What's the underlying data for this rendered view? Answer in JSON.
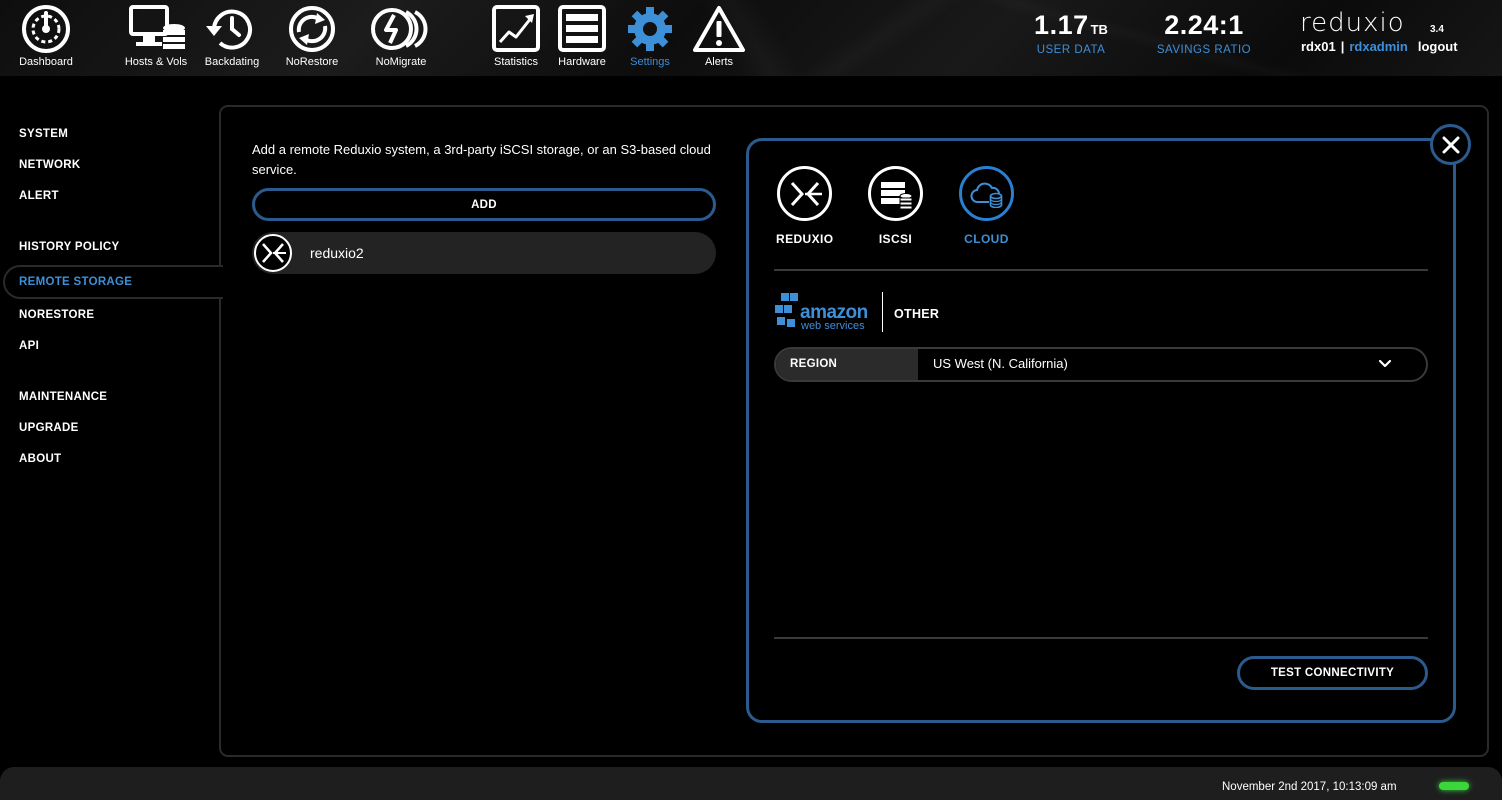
{
  "nav": {
    "items": [
      {
        "label": "Dashboard",
        "icon": "dashboard-gauge-icon"
      },
      {
        "label": "Hosts & Vols",
        "icon": "hosts-volumes-icon"
      },
      {
        "label": "Backdating",
        "icon": "backdating-clock-icon"
      },
      {
        "label": "NoRestore",
        "icon": "norestore-icon"
      },
      {
        "label": "NoMigrate",
        "icon": "nomigrate-icon"
      },
      {
        "label": "Statistics",
        "icon": "statistics-chart-icon"
      },
      {
        "label": "Hardware",
        "icon": "hardware-server-icon"
      },
      {
        "label": "Settings",
        "icon": "settings-gear-icon",
        "active": true
      },
      {
        "label": "Alerts",
        "icon": "alert-warning-icon"
      }
    ]
  },
  "stats": {
    "user_data_value": "1.17",
    "user_data_unit": "TB",
    "user_data_label": "USER DATA",
    "savings_value": "2.24:1",
    "savings_label": "SAVINGS RATIO"
  },
  "brand": {
    "name": "reduxio",
    "version": "3.4",
    "system": "rdx01",
    "separator": "|",
    "user": "rdxadmin",
    "logout": "logout"
  },
  "sidebar": {
    "items": [
      {
        "label": "SYSTEM"
      },
      {
        "label": "NETWORK"
      },
      {
        "label": "ALERT"
      },
      {
        "label": "HISTORY POLICY"
      },
      {
        "label": "REMOTE STORAGE",
        "active": true
      },
      {
        "label": "NORESTORE"
      },
      {
        "label": "API"
      },
      {
        "label": "MAINTENANCE"
      },
      {
        "label": "UPGRADE"
      },
      {
        "label": "ABOUT"
      }
    ]
  },
  "remote_storage": {
    "intro": "Add a remote Reduxio system, a 3rd-party iSCSI storage, or an S3-based cloud service.",
    "add_label": "ADD",
    "entries": [
      {
        "name": "reduxio2",
        "icon": "reduxio-logo-icon"
      }
    ]
  },
  "dialog": {
    "types": [
      {
        "label": "REDUXIO",
        "icon": "reduxio-logo-icon"
      },
      {
        "label": "ISCSI",
        "icon": "iscsi-storage-icon"
      },
      {
        "label": "CLOUD",
        "icon": "cloud-storage-icon",
        "active": true
      }
    ],
    "providers": {
      "aws_main": "amazon",
      "aws_sub": "web services",
      "other": "OTHER"
    },
    "region": {
      "label": "REGION",
      "value": "US West (N. California)"
    },
    "test_label": "TEST CONNECTIVITY"
  },
  "footer": {
    "timestamp": "November 2nd 2017, 10:13:09 am",
    "status": "ok"
  },
  "colors": {
    "accent": "#3d8fd8",
    "border_blue": "#2b5b8e",
    "status_green": "#3bd63b",
    "panel_border": "#2a2a2a"
  }
}
